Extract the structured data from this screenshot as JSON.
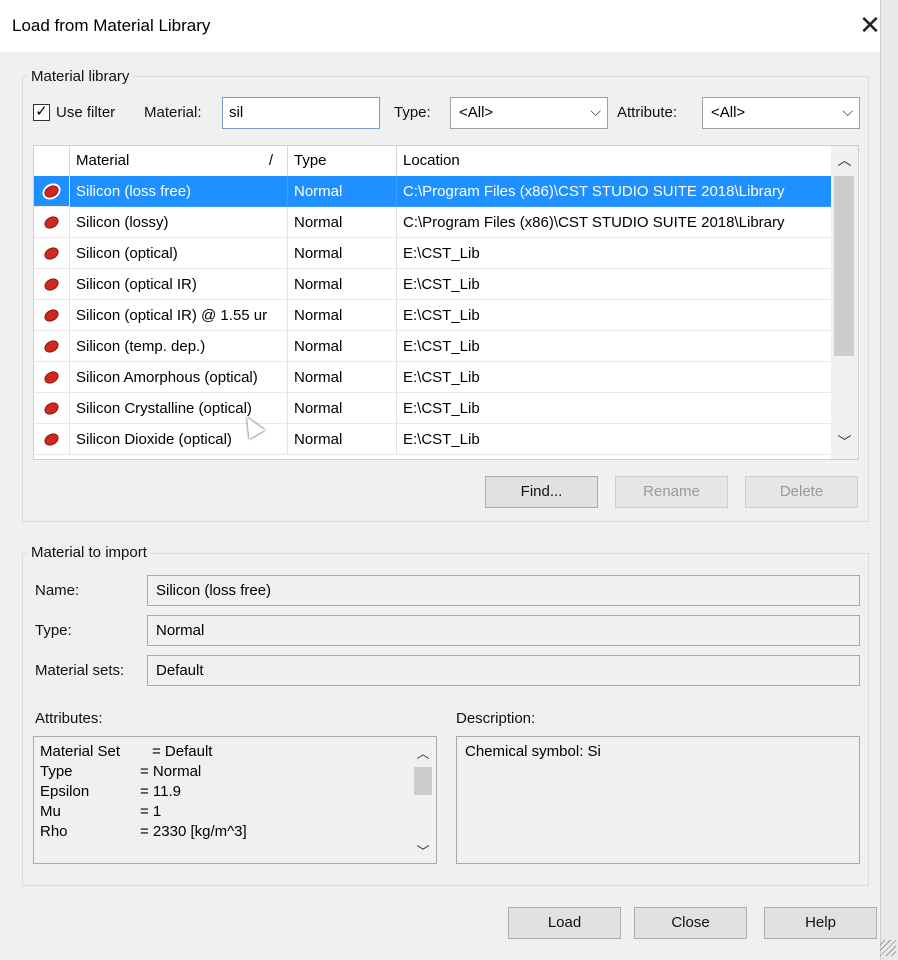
{
  "window": {
    "title": "Load from Material Library"
  },
  "library": {
    "label": "Material library",
    "use_filter_label": "Use filter",
    "use_filter_checked": true,
    "material_label": "Material:",
    "material_value": "sil",
    "type_label": "Type:",
    "type_value": "<All>",
    "attribute_label": "Attribute:",
    "attribute_value": "<All>",
    "columns": [
      "Material",
      "/",
      "Type",
      "Location"
    ],
    "rows": [
      {
        "material": "Silicon (loss free)",
        "type": "Normal",
        "location": "C:\\Program Files (x86)\\CST STUDIO SUITE 2018\\Library",
        "selected": true
      },
      {
        "material": "Silicon (lossy)",
        "type": "Normal",
        "location": "C:\\Program Files (x86)\\CST STUDIO SUITE 2018\\Library",
        "selected": false
      },
      {
        "material": "Silicon (optical)",
        "type": "Normal",
        "location": "E:\\CST_Lib",
        "selected": false
      },
      {
        "material": "Silicon (optical IR)",
        "type": "Normal",
        "location": "E:\\CST_Lib",
        "selected": false
      },
      {
        "material": "Silicon (optical IR) @ 1.55 ur",
        "type": "Normal",
        "location": "E:\\CST_Lib",
        "selected": false
      },
      {
        "material": "Silicon (temp. dep.)",
        "type": "Normal",
        "location": "E:\\CST_Lib",
        "selected": false
      },
      {
        "material": "Silicon Amorphous (optical)",
        "type": "Normal",
        "location": "E:\\CST_Lib",
        "selected": false
      },
      {
        "material": "Silicon Crystalline (optical)",
        "type": "Normal",
        "location": "E:\\CST_Lib",
        "selected": false
      },
      {
        "material": "Silicon Dioxide (optical)",
        "type": "Normal",
        "location": "E:\\CST_Lib",
        "selected": false
      }
    ],
    "buttons": {
      "find": "Find...",
      "rename": "Rename",
      "delete": "Delete"
    }
  },
  "import": {
    "label": "Material to import",
    "name_label": "Name:",
    "name_value": "Silicon (loss free)",
    "type_label": "Type:",
    "type_value": "Normal",
    "sets_label": "Material sets:",
    "sets_value": "Default",
    "attributes_label": "Attributes:",
    "attributes": [
      {
        "key": "Material Set",
        "value": "= Default"
      },
      {
        "key": "Type",
        "value": "= Normal"
      },
      {
        "key": "Epsilon",
        "value": "= 11.9"
      },
      {
        "key": "Mu",
        "value": "= 1"
      },
      {
        "key": "Rho",
        "value": "= 2330 [kg/m^3]"
      }
    ],
    "description_label": "Description:",
    "description_value": "Chemical symbol: Si"
  },
  "footer": {
    "load": "Load",
    "close": "Close",
    "help": "Help"
  },
  "icons": {
    "close": "close-icon",
    "material": "material-gem-icon",
    "dropdown": "chevron-down-icon"
  },
  "colors": {
    "selection": "#1e90ff",
    "gem": "#d0281f"
  }
}
